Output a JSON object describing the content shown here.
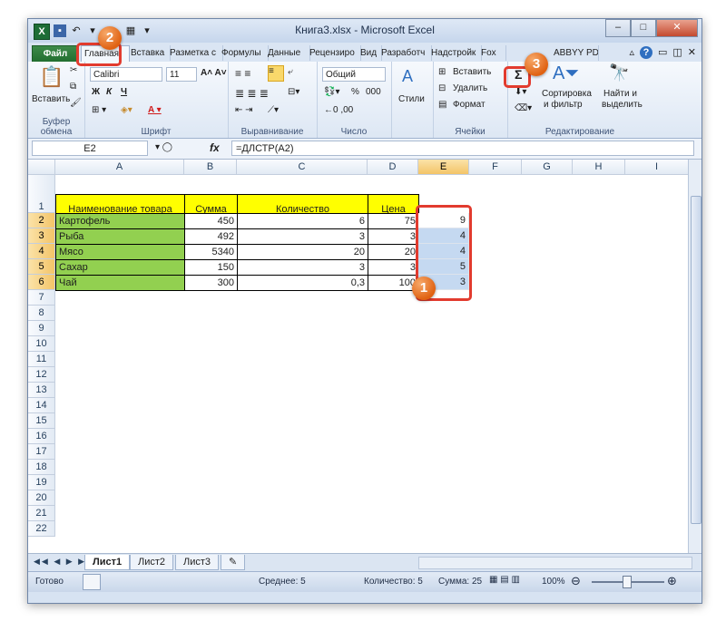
{
  "window": {
    "title": "Книга3.xlsx - Microsoft Excel",
    "app_icon": "X"
  },
  "tabs": [
    "Файл",
    "Главная",
    "Вставка",
    "Разметка с",
    "Формулы",
    "Данные",
    "Рецензиро",
    "Вид",
    "Разработч",
    "Надстройк",
    "Fox",
    "ABBYY PDF"
  ],
  "ribbon": {
    "clipboard": {
      "paste": "Вставить",
      "label": "Буфер обмена"
    },
    "font": {
      "name": "Calibri",
      "size": "11",
      "bold": "Ж",
      "italic": "К",
      "underline": "Ч",
      "label": "Шрифт"
    },
    "alignment": {
      "label": "Выравнивание"
    },
    "number": {
      "format": "Общий",
      "percent": "%",
      "thousands": "000",
      "label": "Число"
    },
    "styles": {
      "label": "Стили"
    },
    "cells": {
      "insert": "Вставить",
      "delete": "Удалить",
      "format": "Формат",
      "label": "Ячейки"
    },
    "editing": {
      "sum": "Σ",
      "sort1": "Сортировка",
      "sort2": "и фильтр",
      "find1": "Найти и",
      "find2": "выделить",
      "label": "Редактирование"
    }
  },
  "formula_bar": {
    "name_box": "E2",
    "fx": "fx",
    "formula": "=ДЛСТР(A2)"
  },
  "columns": [
    "A",
    "B",
    "C",
    "D",
    "E",
    "F",
    "G",
    "H",
    "I"
  ],
  "rows": [
    "1",
    "2",
    "3",
    "4",
    "5",
    "6",
    "7",
    "8",
    "9",
    "10",
    "11",
    "12",
    "13",
    "14",
    "15",
    "16",
    "17",
    "18",
    "19",
    "20",
    "21",
    "22"
  ],
  "table": {
    "headers": [
      "Наименование товара",
      "Сумма",
      "Количество",
      "Цена"
    ],
    "data": [
      {
        "name": "Картофель",
        "sum": "450",
        "qty": "6",
        "price": "75",
        "len": "9"
      },
      {
        "name": "Рыба",
        "sum": "492",
        "qty": "3",
        "price": "3",
        "len": "4"
      },
      {
        "name": "Мясо",
        "sum": "5340",
        "qty": "20",
        "price": "20",
        "len": "4"
      },
      {
        "name": "Сахар",
        "sum": "150",
        "qty": "3",
        "price": "3",
        "len": "5"
      },
      {
        "name": "Чай",
        "sum": "300",
        "qty": "0,3",
        "price": "100",
        "len": "3"
      }
    ]
  },
  "sheets": [
    "Лист1",
    "Лист2",
    "Лист3"
  ],
  "status": {
    "ready": "Готово",
    "average": "Среднее: 5",
    "count": "Количество: 5",
    "sum": "Сумма: 25",
    "zoom": "100%"
  },
  "callouts": [
    "1",
    "2",
    "3"
  ],
  "colors": {
    "yellow": "#ffff00",
    "green": "#92d050",
    "callout": "#e06212",
    "highlight": "#e23b2e"
  }
}
